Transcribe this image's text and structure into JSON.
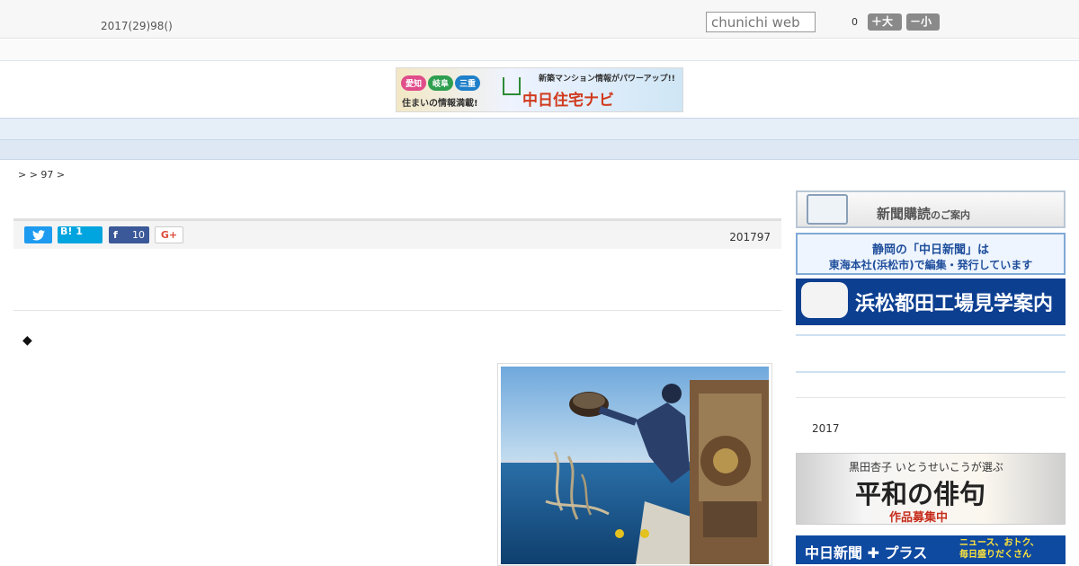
{
  "header": {
    "date": "2017(29)98()",
    "search_placeholder": "chunichi web",
    "fontsize_label": "0",
    "font_bigger": "＋大",
    "font_smaller": "－小"
  },
  "banner": {
    "pills": [
      "愛知",
      "岐阜",
      "三重"
    ],
    "subtitle": "住まいの情報満載!",
    "tagline": "新築マンション情報がパワーアップ!!",
    "title": "中日住宅ナビ"
  },
  "nav": {
    "items": [
      "　　",
      "　　",
      "　　",
      "　　",
      "　　",
      "　　",
      "　　",
      "　　",
      "　　"
    ]
  },
  "breadcrumb": ">  > 97 >",
  "share": {
    "twitter_icon": "twitter-bird",
    "hatena_label": "B! 1",
    "facebook_label": "f",
    "facebook_count": "10",
    "gplus_label": "G+"
  },
  "article": {
    "pubdate": "201797",
    "bullet": "◆"
  },
  "sidebar": {
    "subscribe": {
      "main": "新聞購読",
      "small": "のご案内"
    },
    "shizuoka": {
      "line1": "静岡の「中日新聞」は",
      "line2": "東海本社(浜松市)で編集・発行しています"
    },
    "factory": "浜松都田工場見学案内",
    "year": "2017",
    "haiku": {
      "line1": "黒田杏子  いとうせいこうが選ぶ",
      "line2": "平和の俳句",
      "line3": "作品募集中"
    },
    "plus": {
      "main": "中日新聞 ✚ プラス",
      "side": "ニュース、おトク、\n毎日盛りだくさん"
    }
  },
  "colors": {
    "nav_bg": "#e6eef8",
    "factory_bg": "#0d3f91",
    "plus_bg": "#0f4aa1",
    "accent_red": "#d03a1d"
  }
}
